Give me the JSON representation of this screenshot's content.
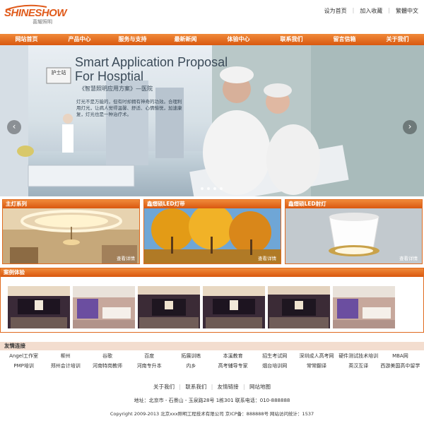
{
  "header": {
    "logo_text": "SHINESHOW",
    "logo_sub": "喜耀照明",
    "top_links": [
      "设为首页",
      "加入收藏",
      "繁體中文"
    ]
  },
  "nav": [
    "网站首页",
    "产品中心",
    "服务与支持",
    "最新新闻",
    "体验中心",
    "联系我们",
    "留言信箱",
    "关于我们"
  ],
  "banner": {
    "title_line1": "Smart Application Proposal",
    "title_line2": "For Hosptial",
    "subtitle": "《智慧照明应用方案》—医院",
    "description": "灯光不是万能的，但有时却拥有神奇的功效。合理利用灯光，让病人觉得温馨、舒适、心情愉悦，加速康复，灯光也是一种治疗术。",
    "sign_text": "护士站",
    "prev_icon": "chevron-left-icon",
    "next_icon": "chevron-right-icon",
    "dots": 4
  },
  "products": [
    {
      "title": "主灯系列",
      "more": "查看详情"
    },
    {
      "title": "鑫熠硕LED灯带",
      "more": "查看详情"
    },
    {
      "title": "鑫熠硕LED射灯",
      "more": "查看详情"
    }
  ],
  "cases": {
    "title": "案例体验",
    "thumb_count": 6
  },
  "friend_links": {
    "title": "友情连接",
    "items": [
      "Angel工作室",
      "柳州",
      "谷歌",
      "百度",
      "拓展训练",
      "本溪教育",
      "招生考试网",
      "深圳成人高考网",
      "硬件测试技术培训",
      "MBA网",
      "PMP培训",
      "郑州会计培训",
      "河南特岗教师",
      "河南专升本",
      "内乡",
      "高考辅导专家",
      "烟台培训网",
      "常常翻译",
      "英汉互译",
      "西游美国高中留学"
    ]
  },
  "footer": {
    "links": [
      "关于我们",
      "联系我们",
      "友情链接",
      "网站地图"
    ],
    "address": "地址：北京市 - 石景山 - 玉泉路28号 1栋301 联系电话：010-888888",
    "copyright": "Copyright 2009-2013 北京xxx照明工程技术有限公司 京ICP备：888888号 网站访问统计：1537"
  }
}
